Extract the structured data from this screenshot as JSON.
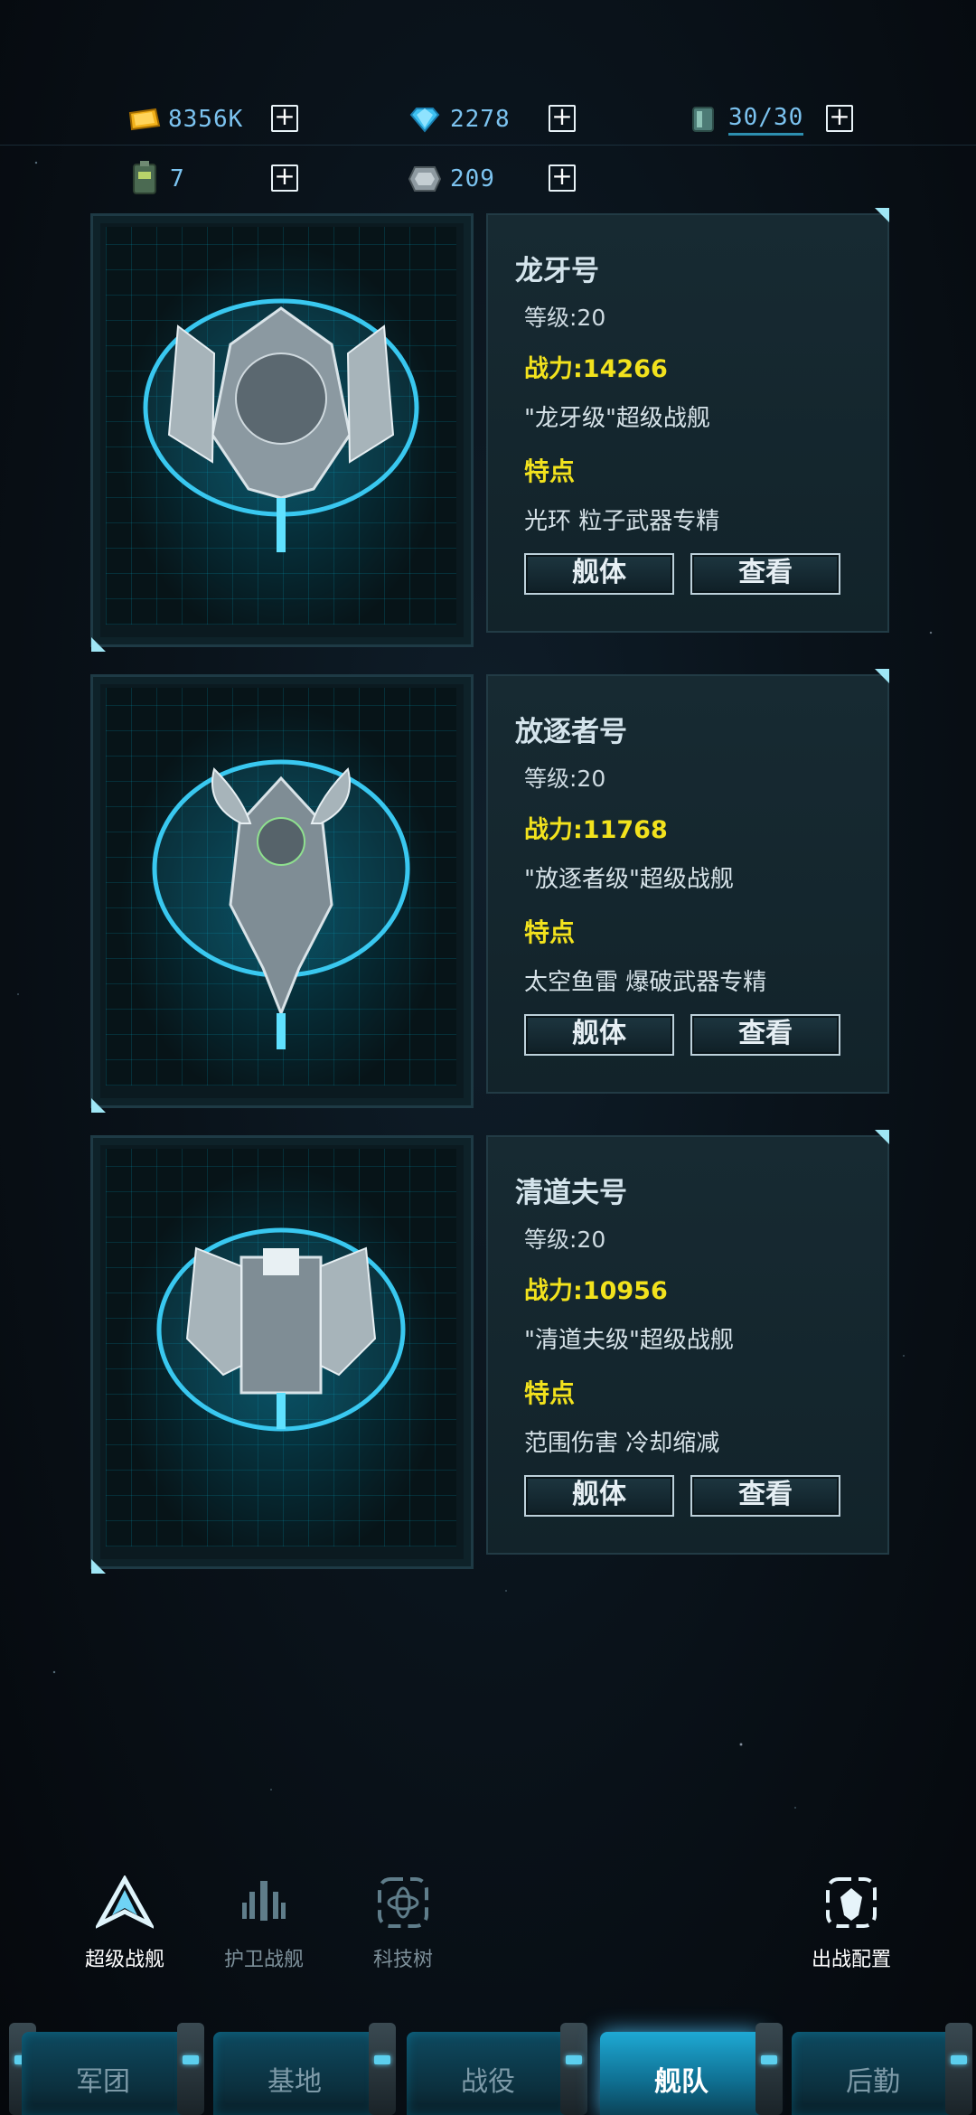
{
  "resources": {
    "row1": [
      {
        "icon": "gold-bar-icon",
        "value": "8356K"
      },
      {
        "icon": "diamond-icon",
        "value": "2278"
      },
      {
        "icon": "fuel-barrel-icon",
        "value": "30/30"
      }
    ],
    "row2": [
      {
        "icon": "battery-icon",
        "value": "7"
      },
      {
        "icon": "alloy-plate-icon",
        "value": "209"
      }
    ]
  },
  "ships": [
    {
      "name": "龙牙号",
      "level": "等级:20",
      "power": "战力:14266",
      "class": "\"龙牙级\"超级战舰",
      "feature_heading": "特点",
      "features": "光环  粒子武器专精",
      "hull_button": "舰体",
      "view_button": "查看"
    },
    {
      "name": "放逐者号",
      "level": "等级:20",
      "power": "战力:11768",
      "class": "\"放逐者级\"超级战舰",
      "feature_heading": "特点",
      "features": "太空鱼雷  爆破武器专精",
      "hull_button": "舰体",
      "view_button": "查看"
    },
    {
      "name": "清道夫号",
      "level": "等级:20",
      "power": "战力:10956",
      "class": "\"清道夫级\"超级战舰",
      "feature_heading": "特点",
      "features": "范围伤害  冷却缩减",
      "hull_button": "舰体",
      "view_button": "查看"
    }
  ],
  "sub_tabs": [
    {
      "label": "超级战舰",
      "icon": "super-warship-icon",
      "active": true
    },
    {
      "label": "护卫战舰",
      "icon": "escort-warship-icon",
      "active": false
    },
    {
      "label": "科技树",
      "icon": "tech-tree-icon",
      "active": false
    },
    {
      "label": "出战配置",
      "icon": "battle-config-icon",
      "active": false
    }
  ],
  "nav": [
    {
      "label": "军团",
      "active": false
    },
    {
      "label": "基地",
      "active": false
    },
    {
      "label": "战役",
      "active": false
    },
    {
      "label": "舰队",
      "active": true
    },
    {
      "label": "后勤",
      "active": false
    }
  ],
  "colors": {
    "accent": "#7cc3f0",
    "power": "#f2e21d",
    "active_nav": "#1ea9d4"
  }
}
